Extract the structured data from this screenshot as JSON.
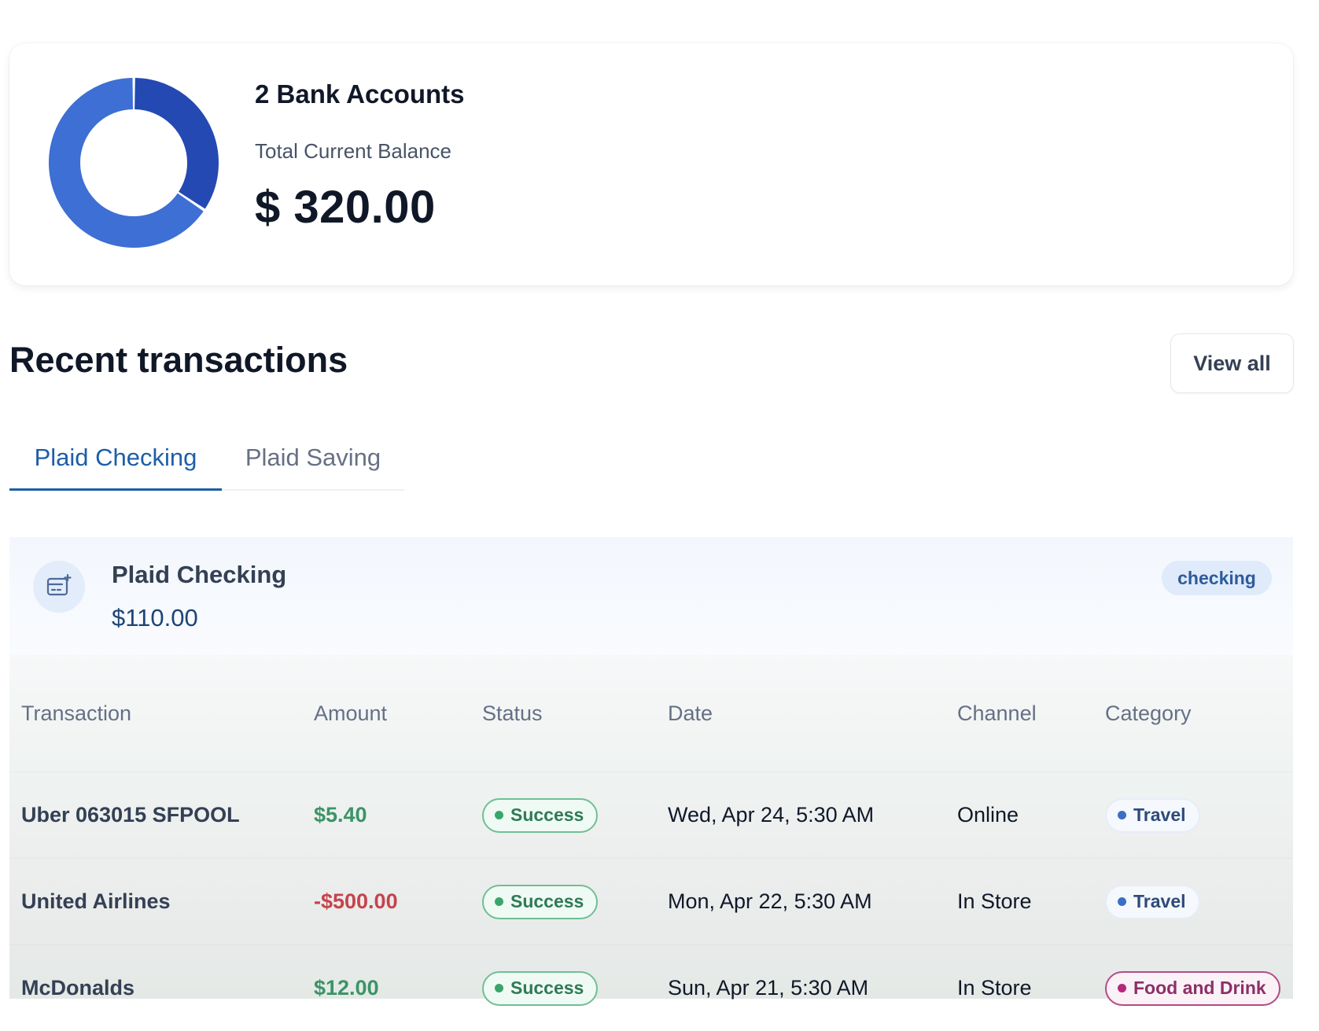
{
  "balance_card": {
    "accounts_title": "2 Bank Accounts",
    "balance_label": "Total Current Balance",
    "balance_value": "$ 320.00",
    "donut": {
      "segments": [
        {
          "value": 210,
          "color": "#3d6fd4"
        },
        {
          "value": 110,
          "color": "#2449b3"
        }
      ]
    }
  },
  "transactions_section": {
    "title": "Recent transactions",
    "view_all_label": "View all"
  },
  "tabs": [
    {
      "label": "Plaid Checking",
      "active": true
    },
    {
      "label": "Plaid Saving",
      "active": false
    }
  ],
  "account": {
    "icon": "card-plus-icon",
    "name": "Plaid Checking",
    "balance": "$110.00",
    "type_badge": "checking"
  },
  "table": {
    "headers": [
      "Transaction",
      "Amount",
      "Status",
      "Date",
      "Channel",
      "Category"
    ],
    "rows": [
      {
        "name": "Uber 063015 SFPOOL",
        "amount": "$5.40",
        "amount_sign": "positive",
        "status": "Success",
        "date": "Wed, Apr 24, 5:30 AM",
        "channel": "Online",
        "category": "Travel"
      },
      {
        "name": "United Airlines",
        "amount": "-$500.00",
        "amount_sign": "negative",
        "status": "Success",
        "date": "Mon, Apr 22, 5:30 AM",
        "channel": "In Store",
        "category": "Travel"
      },
      {
        "name": "McDonalds",
        "amount": "$12.00",
        "amount_sign": "positive",
        "status": "Success",
        "date": "Sun, Apr 21, 5:30 AM",
        "channel": "In Store",
        "category": "Food and Drink"
      }
    ]
  },
  "colors": {
    "accent": "#1d5ea8",
    "positive_amount": "#3c9466",
    "negative_amount": "#c6434c",
    "success": "#3aa56a",
    "travel": "#3b6fc4",
    "food_and_drink": "#b4287c"
  }
}
